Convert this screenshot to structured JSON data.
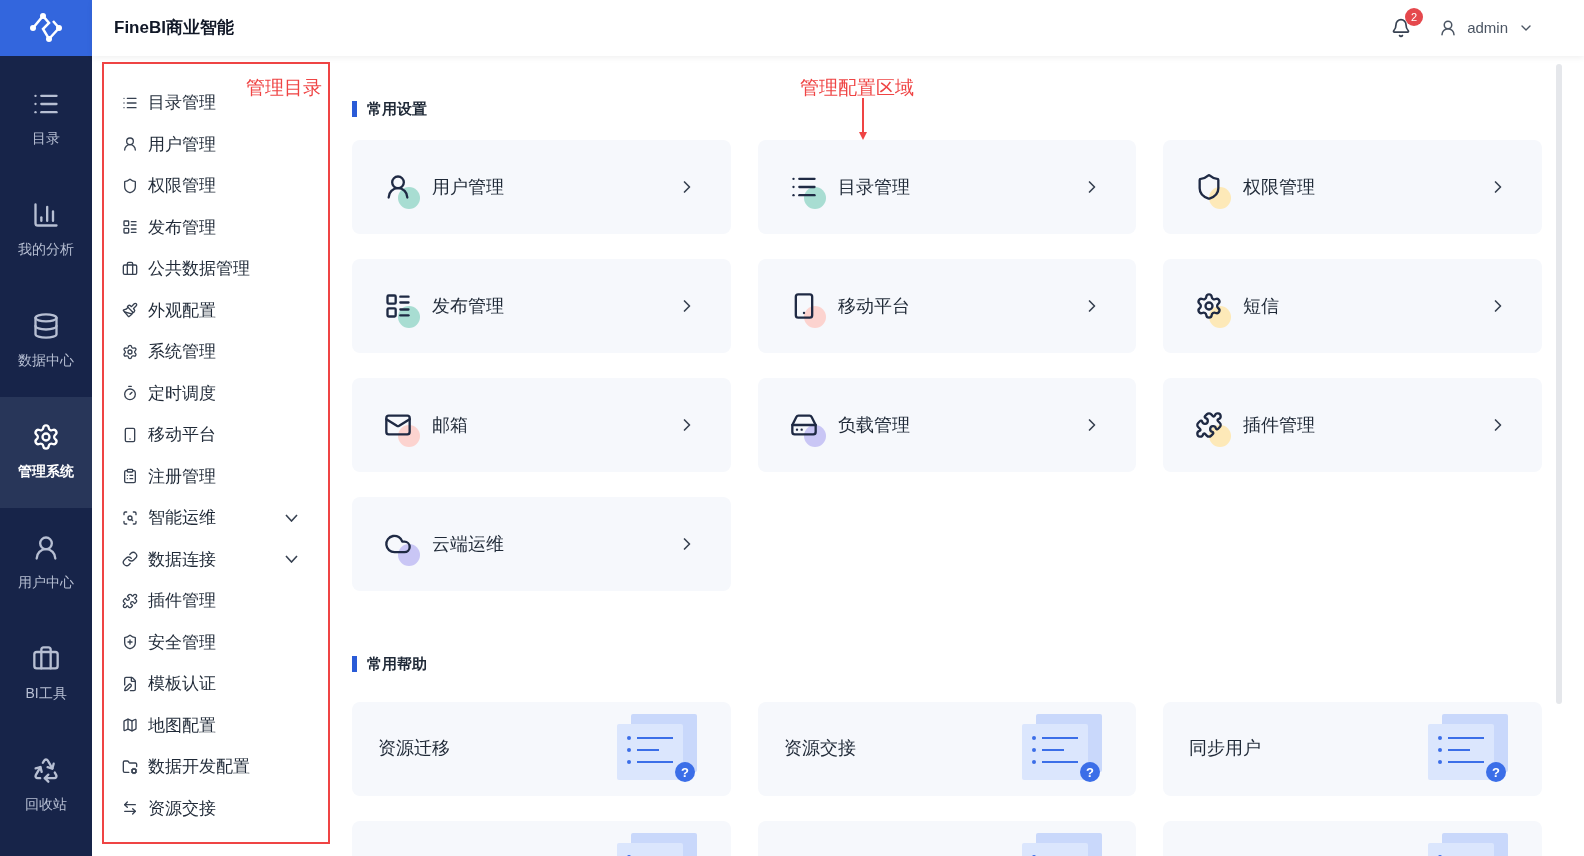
{
  "app": {
    "title": "FineBI商业智能",
    "notifications": "2",
    "user": "admin"
  },
  "nav": [
    {
      "label": "目录",
      "selected": false
    },
    {
      "label": "我的分析",
      "selected": false
    },
    {
      "label": "数据中心",
      "selected": false
    },
    {
      "label": "管理系统",
      "selected": true
    },
    {
      "label": "用户中心",
      "selected": false
    },
    {
      "label": "BI工具",
      "selected": false
    },
    {
      "label": "回收站",
      "selected": false
    }
  ],
  "sidebar": {
    "annotation": "管理目录",
    "items": [
      {
        "label": "目录管理"
      },
      {
        "label": "用户管理"
      },
      {
        "label": "权限管理"
      },
      {
        "label": "发布管理"
      },
      {
        "label": "公共数据管理"
      },
      {
        "label": "外观配置"
      },
      {
        "label": "系统管理"
      },
      {
        "label": "定时调度"
      },
      {
        "label": "移动平台"
      },
      {
        "label": "注册管理"
      },
      {
        "label": "智能运维",
        "expanded": false
      },
      {
        "label": "数据连接",
        "expanded": false
      },
      {
        "label": "插件管理"
      },
      {
        "label": "安全管理"
      },
      {
        "label": "模板认证"
      },
      {
        "label": "地图配置"
      },
      {
        "label": "数据开发配置"
      },
      {
        "label": "资源交接"
      }
    ]
  },
  "main": {
    "annotation": "管理配置区域",
    "settings": {
      "title": "常用设置",
      "cards": [
        {
          "label": "用户管理",
          "color": "#a8ddd2"
        },
        {
          "label": "目录管理",
          "color": "#a8ddd2"
        },
        {
          "label": "权限管理",
          "color": "#fde9b8"
        },
        {
          "label": "发布管理",
          "color": "#a8ddd2"
        },
        {
          "label": "移动平台",
          "color": "#fcd3cf"
        },
        {
          "label": "短信",
          "color": "#fde9b8"
        },
        {
          "label": "邮箱",
          "color": "#fcd3cf"
        },
        {
          "label": "负载管理",
          "color": "#c9c6f5"
        },
        {
          "label": "插件管理",
          "color": "#fde9b8"
        },
        {
          "label": "云端运维",
          "color": "#c9c6f5"
        }
      ]
    },
    "help": {
      "title": "常用帮助",
      "cards": [
        {
          "label": "资源迁移",
          "badge": "?"
        },
        {
          "label": "资源交接",
          "badge": "?"
        },
        {
          "label": "同步用户",
          "badge": "?"
        }
      ]
    }
  }
}
